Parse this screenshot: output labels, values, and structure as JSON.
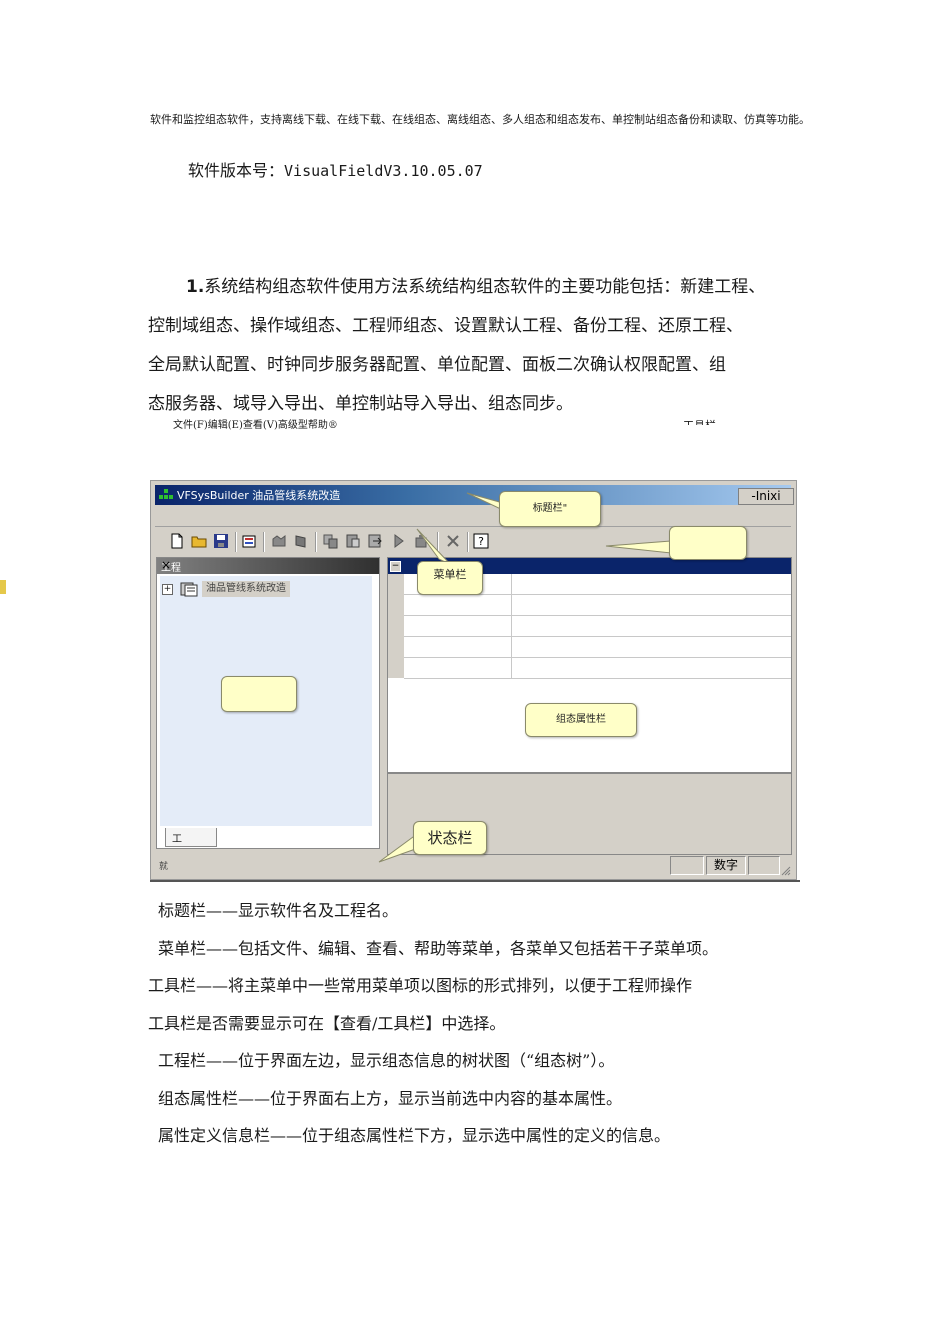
{
  "intro": "软件和监控组态软件，支持离线下载、在线下载、在线组态、离线组态、多人组态和组态发布、单控制站组态备份和读取、仿真等功能。",
  "version": {
    "label": "软件版本号：",
    "value": "VisualFieldV3.10.05.07"
  },
  "section": {
    "number": "1.",
    "lines": [
      "系统结构组态软件使用方法系统结构组态软件的主要功能包括：新建工程、",
      "控制域组态、操作域组态、工程师组态、设置默认工程、备份工程、还原工程、",
      "全局默认配置、时钟同步服务器配置、单位配置、面板二次确认权限配置、组",
      "态服务器、域导入导出、单控制站导入导出、组态同步。"
    ]
  },
  "figure": {
    "menu_line": "文件(F)编辑(E)查看(V)高级型帮助®",
    "toolbar_label_top": "工具栏",
    "window": {
      "app_name": "VFSysBuilder 油品管线系统改造",
      "window_controls": "-Inixi",
      "left_panel_title": "工程",
      "close_glyph": "×",
      "tree_plus": "+",
      "tree_node": "油品管线系统改造",
      "tree_tab": "工",
      "grid_minus": "⊟",
      "status_left": "就",
      "status_num": "数字"
    },
    "callouts": {
      "title_bar": "标题栏\"",
      "menu_bar": "菜单栏",
      "config_attr": "组态属性栏",
      "status_bar": "状态栏"
    }
  },
  "descriptions": [
    "标题栏——显示软件名及工程名。",
    "菜单栏——包括文件、编辑、查看、帮助等菜单，各菜单又包括若干子菜单项。",
    "工具栏——将主菜单中一些常用菜单项以图标的形式排列，以便于工程师操作",
    "工具栏是否需要显示可在【查看/工具栏】中选择。",
    "工程栏——位于界面左边，显示组态信息的树状图（“组态树”）。",
    "组态属性栏——位于界面右上方，显示当前选中内容的基本属性。",
    "属性定义信息栏——位于组态属性栏下方，显示选中属性的定义的信息。"
  ],
  "colors": {
    "titlebar_start": "#0a246a",
    "window_face": "#d4d0c8",
    "tree_bg": "#e4ecf8",
    "callout_fill": "#ffffc8"
  }
}
